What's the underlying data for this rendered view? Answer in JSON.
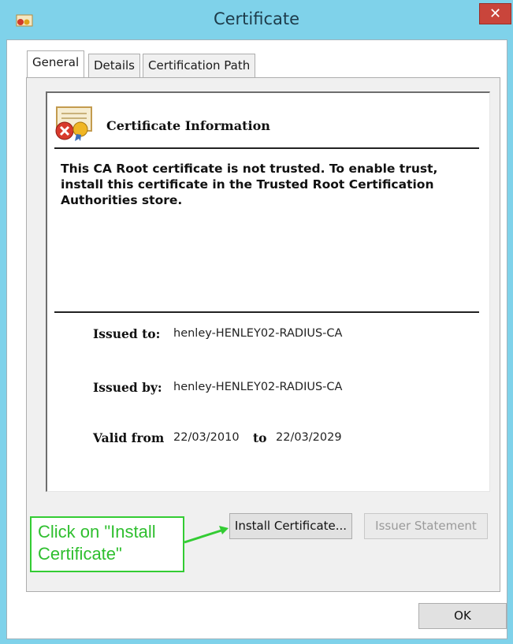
{
  "window": {
    "title": "Certificate",
    "close_symbol": "✕",
    "icons": {
      "title_icon": "certificate-icon",
      "close": "close-icon"
    }
  },
  "tabs": [
    {
      "label": "General",
      "active": true
    },
    {
      "label": "Details",
      "active": false
    },
    {
      "label": "Certification Path",
      "active": false
    }
  ],
  "general": {
    "heading": "Certificate Information",
    "heading_icon": "certificate-error-icon",
    "warning": "This CA Root certificate is not trusted. To enable trust, install this certificate in the Trusted Root Certification Authorities store.",
    "issued_to_label": "Issued to:",
    "issued_to_value": "henley-HENLEY02-RADIUS-CA",
    "issued_by_label": "Issued by:",
    "issued_by_value": "henley-HENLEY02-RADIUS-CA",
    "valid_from_label": "Valid from",
    "valid_from_value": "22/03/2010",
    "valid_to_label": "to",
    "valid_to_value": "22/03/2029"
  },
  "buttons": {
    "install": "Install Certificate...",
    "issuer_statement": "Issuer Statement",
    "ok": "OK"
  },
  "annotation": {
    "text": "Click on \"Install Certificate\"",
    "color": "#33cc33"
  }
}
